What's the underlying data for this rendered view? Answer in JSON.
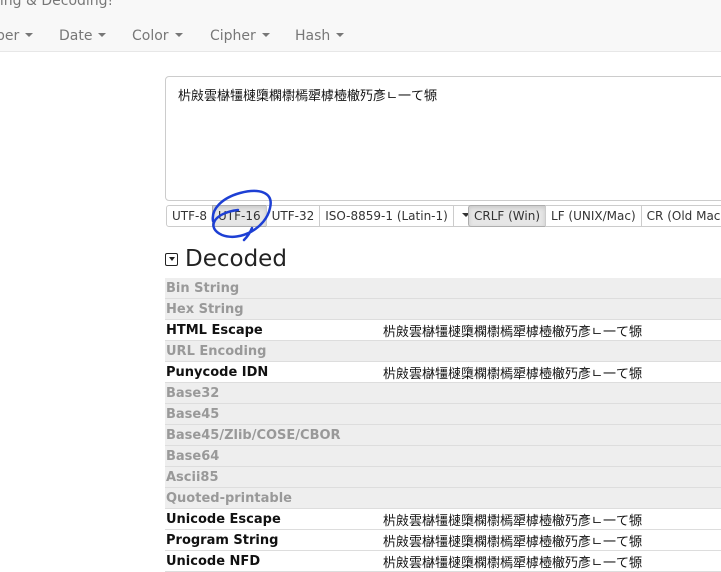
{
  "brand": {
    "text": "ling & Decoding!"
  },
  "nav": [
    {
      "label": "ber"
    },
    {
      "label": "Date"
    },
    {
      "label": "Color"
    },
    {
      "label": "Cipher"
    },
    {
      "label": "Hash"
    }
  ],
  "input": {
    "value": "㭊㪐雲㯎㹔㯈㯐㯗㯹㯊㹕㯉㯛㯙㱙彥ㄴ一て㹉"
  },
  "encodings": [
    {
      "label": "UTF-8"
    },
    {
      "label": "UTF-16"
    },
    {
      "label": "UTF-32"
    },
    {
      "label": "ISO-8859-1 (Latin-1)"
    }
  ],
  "line_endings": [
    {
      "label": "CRLF (Win)"
    },
    {
      "label": "LF (UNIX/Mac)"
    },
    {
      "label": "CR (Old Mac)"
    }
  ],
  "section": {
    "title": "Decoded"
  },
  "rows": [
    {
      "label": "Bin String",
      "value": ""
    },
    {
      "label": "Hex String",
      "value": ""
    },
    {
      "label": "HTML Escape",
      "value": "㭊㪐雲㯎㹔㯈㯐㯗㯹㯊㹕㯉㯛㯙㱙彥ㄴ一て㹉"
    },
    {
      "label": "URL Encoding",
      "value": ""
    },
    {
      "label": "Punycode IDN",
      "value": "㭊㪐雲㯎㹔㯈㯐㯗㯹㯊㹕㯉㯛㯙㱙彥ㄴ一て㹉"
    },
    {
      "label": "Base32",
      "value": ""
    },
    {
      "label": "Base45",
      "value": ""
    },
    {
      "label": "Base45/Zlib/COSE/CBOR",
      "value": ""
    },
    {
      "label": "Base64",
      "value": ""
    },
    {
      "label": "Ascii85",
      "value": ""
    },
    {
      "label": "Quoted-printable",
      "value": ""
    },
    {
      "label": "Unicode Escape",
      "value": "㭊㪐雲㯎㹔㯈㯐㯗㯹㯊㹕㯉㯛㯙㱙彥ㄴ一て㹉"
    },
    {
      "label": "Program String",
      "value": "㭊㪐雲㯎㹔㯈㯐㯗㯹㯊㹕㯉㯛㯙㱙彥ㄴ一て㹉"
    },
    {
      "label": "Unicode NFD",
      "value": "㭊㪐雲㯎㹔㯈㯐㯗㯹㯊㹕㯉㯛㯙㱙彥ㄴ一て㹉"
    }
  ]
}
